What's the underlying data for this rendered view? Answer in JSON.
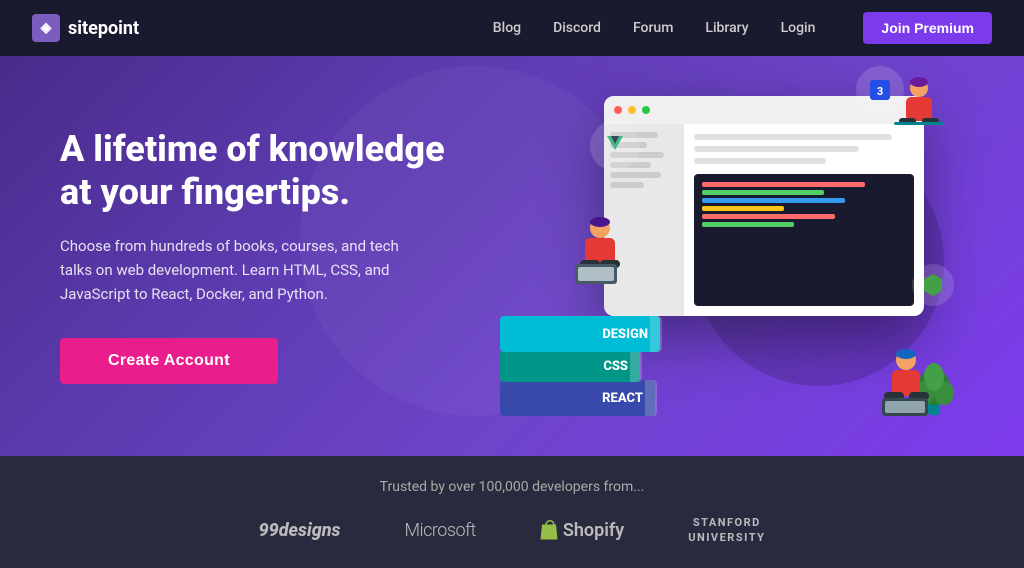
{
  "nav": {
    "logo_text": "sitepoint",
    "links": [
      "Blog",
      "Discord",
      "Forum",
      "Library",
      "Login"
    ],
    "join_label": "Join Premium"
  },
  "hero": {
    "title": "A lifetime of knowledge at your fingertips.",
    "description": "Choose from hundreds of books, courses, and tech talks on web development. Learn HTML, CSS, and JavaScript to React, Docker, and Python.",
    "cta_label": "Create Account"
  },
  "books": [
    {
      "label": "DESIGN",
      "color": "#00bcd4"
    },
    {
      "label": "CSS",
      "color": "#009688"
    },
    {
      "label": "REACT",
      "color": "#3949ab"
    }
  ],
  "trusted": {
    "heading": "Trusted by over 100,000 developers from...",
    "logos": [
      "99designs",
      "Microsoft",
      "Shopify",
      "STANFORD UNIVERSITY"
    ]
  }
}
